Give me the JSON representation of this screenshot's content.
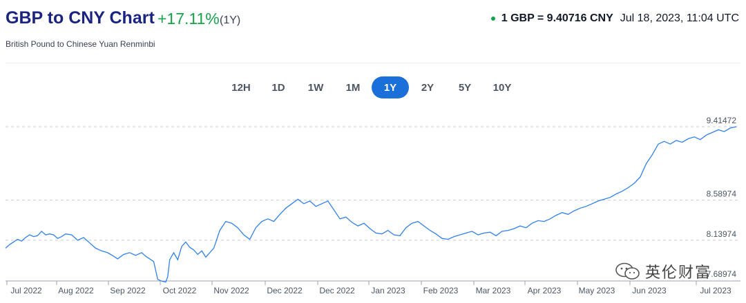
{
  "header": {
    "title": "GBP to CNY Chart",
    "change": "+17.11%",
    "period": "(1Y)",
    "subtitle": "British Pound to Chinese Yuan Renminbi",
    "rate": "1 GBP = 9.40716 CNY",
    "timestamp": "Jul 18, 2023, 11:04 UTC"
  },
  "ranges": [
    {
      "label": "12H",
      "active": false
    },
    {
      "label": "1D",
      "active": false
    },
    {
      "label": "1W",
      "active": false
    },
    {
      "label": "1M",
      "active": false
    },
    {
      "label": "1Y",
      "active": true
    },
    {
      "label": "2Y",
      "active": false
    },
    {
      "label": "5Y",
      "active": false
    },
    {
      "label": "10Y",
      "active": false
    }
  ],
  "watermark": {
    "text": "英伦财富",
    "icon": "wechat-icon"
  },
  "colors": {
    "line": "#2f80ed",
    "accent": "#1a6fd8",
    "positive": "#16a34a",
    "title": "#1a2380"
  },
  "chart_data": {
    "type": "line",
    "title": "GBP to CNY Chart",
    "ylabel": "",
    "xlabel": "",
    "y_ticks": [
      "9.41472",
      "8.58974",
      "8.13974",
      "7.68974"
    ],
    "x_tick_labels": [
      "Jul 2022",
      "Aug 2022",
      "Sep 2022",
      "Oct 2022",
      "Nov 2022",
      "Dec 2022",
      "Dec 2022",
      "Jan 2023",
      "Feb 2023",
      "Mar 2023",
      "Apr 2023",
      "May 2023",
      "Jun 2023",
      "Jul 2023"
    ],
    "grid": "horizontal-dashed",
    "series": [
      {
        "values": [
          [
            0,
            8.05
          ],
          [
            2,
            8.09
          ],
          [
            4,
            8.12
          ],
          [
            6,
            8.15
          ],
          [
            8,
            8.13
          ],
          [
            10,
            8.17
          ],
          [
            12,
            8.2
          ],
          [
            14,
            8.18
          ],
          [
            16,
            8.19
          ],
          [
            18,
            8.24
          ],
          [
            20,
            8.2
          ],
          [
            22,
            8.21
          ],
          [
            24,
            8.2
          ],
          [
            26,
            8.16
          ],
          [
            28,
            8.18
          ],
          [
            30,
            8.21
          ],
          [
            33,
            8.2
          ],
          [
            36,
            8.14
          ],
          [
            39,
            8.17
          ],
          [
            42,
            8.11
          ],
          [
            45,
            8.05
          ],
          [
            48,
            8.02
          ],
          [
            51,
            8.0
          ],
          [
            54,
            7.96
          ],
          [
            56,
            7.93
          ],
          [
            59,
            7.98
          ],
          [
            62,
            8.0
          ],
          [
            65,
            7.97
          ],
          [
            68,
            8.0
          ],
          [
            70,
            7.96
          ],
          [
            72,
            7.93
          ],
          [
            74,
            7.9
          ],
          [
            76,
            7.7
          ],
          [
            78,
            7.68
          ],
          [
            80,
            7.67
          ],
          [
            81,
            7.73
          ],
          [
            82,
            7.92
          ],
          [
            84,
            8.0
          ],
          [
            86,
            7.92
          ],
          [
            88,
            8.07
          ],
          [
            90,
            8.12
          ],
          [
            92,
            8.06
          ],
          [
            94,
            8.03
          ],
          [
            96,
            7.98
          ],
          [
            98,
            8.02
          ],
          [
            100,
            7.95
          ],
          [
            104,
            8.05
          ],
          [
            107,
            8.25
          ],
          [
            110,
            8.35
          ],
          [
            113,
            8.33
          ],
          [
            116,
            8.28
          ],
          [
            119,
            8.2
          ],
          [
            122,
            8.15
          ],
          [
            125,
            8.28
          ],
          [
            128,
            8.35
          ],
          [
            131,
            8.38
          ],
          [
            134,
            8.35
          ],
          [
            137,
            8.43
          ],
          [
            140,
            8.5
          ],
          [
            143,
            8.55
          ],
          [
            146,
            8.6
          ],
          [
            149,
            8.55
          ],
          [
            152,
            8.58
          ],
          [
            155,
            8.52
          ],
          [
            158,
            8.55
          ],
          [
            161,
            8.58
          ],
          [
            164,
            8.48
          ],
          [
            167,
            8.38
          ],
          [
            170,
            8.4
          ],
          [
            173,
            8.34
          ],
          [
            176,
            8.3
          ],
          [
            179,
            8.33
          ],
          [
            182,
            8.27
          ],
          [
            185,
            8.22
          ],
          [
            188,
            8.21
          ],
          [
            191,
            8.25
          ],
          [
            194,
            8.2
          ],
          [
            197,
            8.19
          ],
          [
            200,
            8.28
          ],
          [
            203,
            8.33
          ],
          [
            206,
            8.35
          ],
          [
            209,
            8.3
          ],
          [
            212,
            8.25
          ],
          [
            215,
            8.21
          ],
          [
            218,
            8.16
          ],
          [
            221,
            8.15
          ],
          [
            224,
            8.18
          ],
          [
            227,
            8.2
          ],
          [
            230,
            8.22
          ],
          [
            233,
            8.24
          ],
          [
            236,
            8.2
          ],
          [
            239,
            8.22
          ],
          [
            242,
            8.23
          ],
          [
            245,
            8.19
          ],
          [
            248,
            8.24
          ],
          [
            251,
            8.25
          ],
          [
            254,
            8.27
          ],
          [
            257,
            8.3
          ],
          [
            260,
            8.28
          ],
          [
            263,
            8.33
          ],
          [
            266,
            8.36
          ],
          [
            269,
            8.35
          ],
          [
            272,
            8.38
          ],
          [
            275,
            8.42
          ],
          [
            278,
            8.45
          ],
          [
            281,
            8.43
          ],
          [
            284,
            8.47
          ],
          [
            287,
            8.5
          ],
          [
            290,
            8.52
          ],
          [
            293,
            8.55
          ],
          [
            296,
            8.58
          ],
          [
            299,
            8.6
          ],
          [
            302,
            8.62
          ],
          [
            305,
            8.66
          ],
          [
            308,
            8.69
          ],
          [
            311,
            8.73
          ],
          [
            314,
            8.78
          ],
          [
            317,
            8.85
          ],
          [
            320,
            9.0
          ],
          [
            323,
            9.1
          ],
          [
            326,
            9.22
          ],
          [
            329,
            9.25
          ],
          [
            332,
            9.22
          ],
          [
            335,
            9.26
          ],
          [
            338,
            9.24
          ],
          [
            341,
            9.28
          ],
          [
            344,
            9.3
          ],
          [
            347,
            9.27
          ],
          [
            350,
            9.32
          ],
          [
            353,
            9.35
          ],
          [
            356,
            9.38
          ],
          [
            359,
            9.36
          ],
          [
            362,
            9.4
          ],
          [
            365,
            9.41472
          ]
        ]
      }
    ]
  }
}
